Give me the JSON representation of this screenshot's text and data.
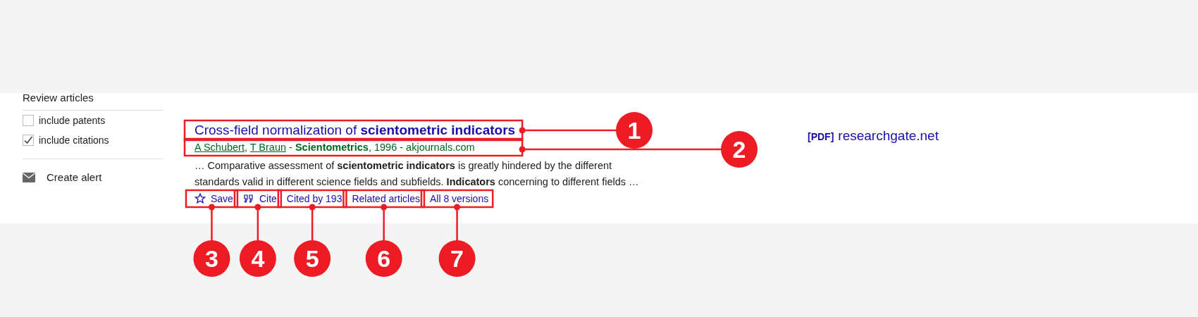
{
  "sidebar": {
    "heading": "Review articles",
    "options": [
      {
        "label": "include patents",
        "checked": false
      },
      {
        "label": "include citations",
        "checked": true
      }
    ],
    "alert": "Create alert"
  },
  "result": {
    "title": "Cross-field normalization of **scientometric indicators**",
    "authors": [
      "A Schubert",
      "T Braun"
    ],
    "author_separator": ",",
    "venue": "- **Scientometrics**, 1996 - akjournals.com",
    "snippet": [
      "… Comparative assessment of **scientometric indicators** is greatly hindered by the different",
      "standards valid in different science fields and subfields. **Indicators** concerning to different fields …"
    ],
    "actions": [
      {
        "kind": "save",
        "label": "Save"
      },
      {
        "kind": "cite",
        "label": "Cite"
      },
      {
        "kind": "link",
        "label": "Cited by 193"
      },
      {
        "kind": "link",
        "label": "Related articles"
      },
      {
        "kind": "link",
        "label": "All 8 versions"
      }
    ],
    "full_text": {
      "tag": "[PDF]",
      "domain": "researchgate.net"
    }
  },
  "callouts": [
    {
      "number": "1"
    },
    {
      "number": "2"
    },
    {
      "number": "3"
    },
    {
      "number": "4"
    },
    {
      "number": "5"
    },
    {
      "number": "6"
    },
    {
      "number": "7"
    }
  ]
}
